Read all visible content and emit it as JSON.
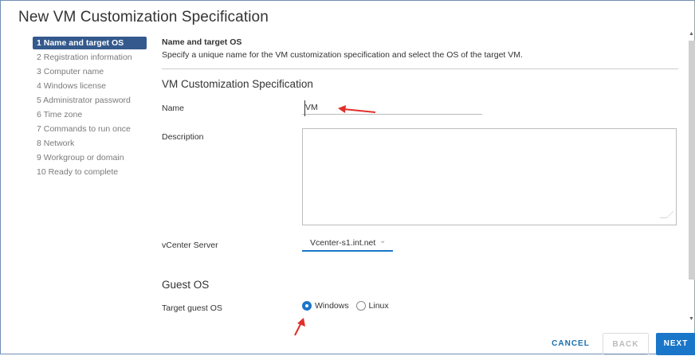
{
  "dialog": {
    "title": "New VM Customization Specification"
  },
  "steps": [
    {
      "label": "1 Name and target OS",
      "active": true
    },
    {
      "label": "2 Registration information"
    },
    {
      "label": "3 Computer name"
    },
    {
      "label": "4 Windows license"
    },
    {
      "label": "5 Administrator password"
    },
    {
      "label": "6 Time zone"
    },
    {
      "label": "7 Commands to run once"
    },
    {
      "label": "8 Network"
    },
    {
      "label": "9 Workgroup or domain"
    },
    {
      "label": "10 Ready to complete"
    }
  ],
  "header": {
    "title": "Name and target OS",
    "description": "Specify a unique name for the VM customization specification and select the OS of the target VM."
  },
  "spec": {
    "section_title": "VM Customization Specification",
    "name_label": "Name",
    "name_value": "VM",
    "description_label": "Description",
    "description_value": "",
    "vcenter_label": "vCenter Server",
    "vcenter_value": "Vcenter-s1.int.net"
  },
  "guest_os": {
    "section_title": "Guest OS",
    "target_label": "Target guest OS",
    "options": [
      {
        "label": "Windows",
        "selected": true
      },
      {
        "label": "Linux",
        "selected": false
      }
    ]
  },
  "footer": {
    "cancel": "CANCEL",
    "back": "BACK",
    "next": "NEXT"
  },
  "colors": {
    "accent": "#1a76c9",
    "active_step": "#34598c",
    "annotation_arrow": "#e0302a"
  }
}
